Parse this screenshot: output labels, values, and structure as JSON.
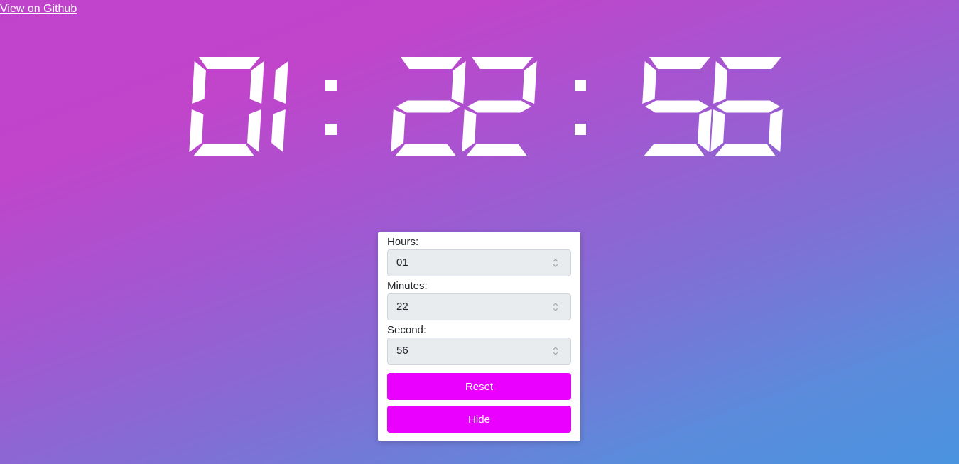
{
  "header": {
    "github_link": "View on Github"
  },
  "clock": {
    "hours": "01",
    "minutes": "22",
    "seconds": "56",
    "separator": ":",
    "digit_color": "#ffffff"
  },
  "form": {
    "hours_label": "Hours:",
    "hours_value": "01",
    "minutes_label": "Minutes:",
    "minutes_value": "22",
    "seconds_label": "Second:",
    "seconds_value": "56",
    "reset_label": "Reset",
    "hide_label": "Hide",
    "button_color": "#ea00ff"
  },
  "icons": {
    "spinner": "chevron-up-down-icon"
  }
}
